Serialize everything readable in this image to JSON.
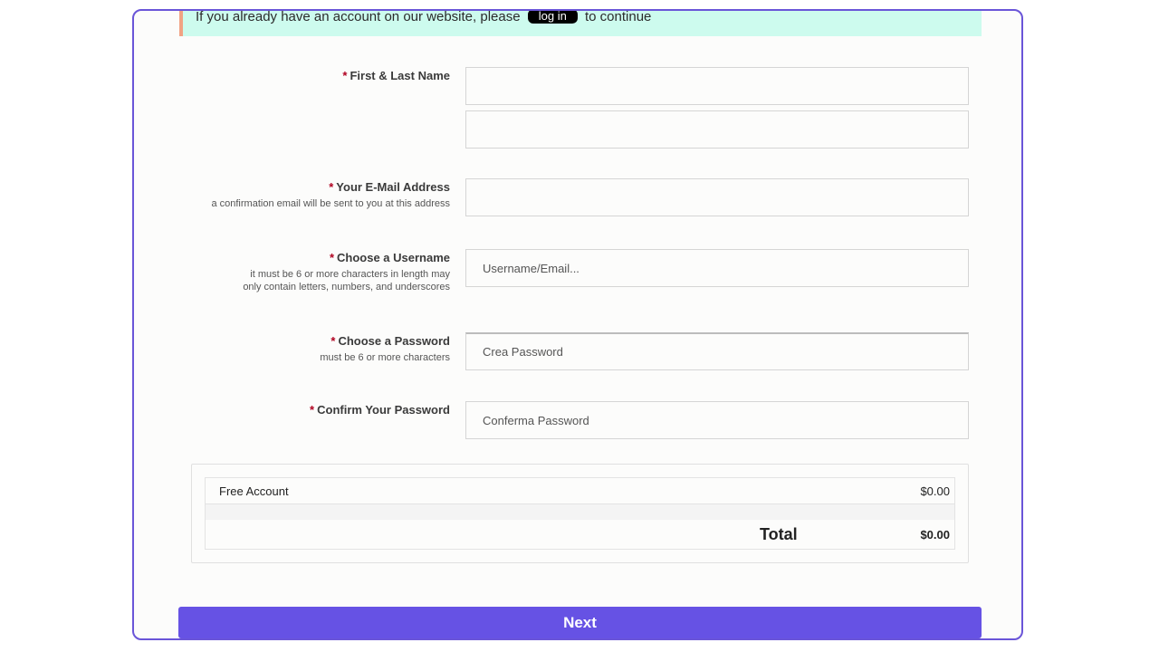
{
  "login_banner": {
    "text_before": "If you already have an account on our website, please",
    "login_label": "log in",
    "text_after": "to continue"
  },
  "form": {
    "required_marker": "*",
    "name": {
      "label": "First & Last Name",
      "first_value": "",
      "last_value": ""
    },
    "email": {
      "label": "Your E-Mail Address",
      "help": "a confirmation email will be sent to you at this address",
      "value": ""
    },
    "username": {
      "label": "Choose a Username",
      "help": "it must be 6 or more characters in length may only contain letters, numbers, and underscores",
      "placeholder": "Username/Email..."
    },
    "password": {
      "label": "Choose a Password",
      "help": "must be 6 or more characters",
      "placeholder": "Crea Password"
    },
    "confirm_password": {
      "label": "Confirm Your Password",
      "placeholder": "Conferma Password"
    }
  },
  "summary": {
    "item_name": "Free Account",
    "item_price": "$0.00",
    "total_label": "Total",
    "total_value": "$0.00"
  },
  "next_label": "Next"
}
